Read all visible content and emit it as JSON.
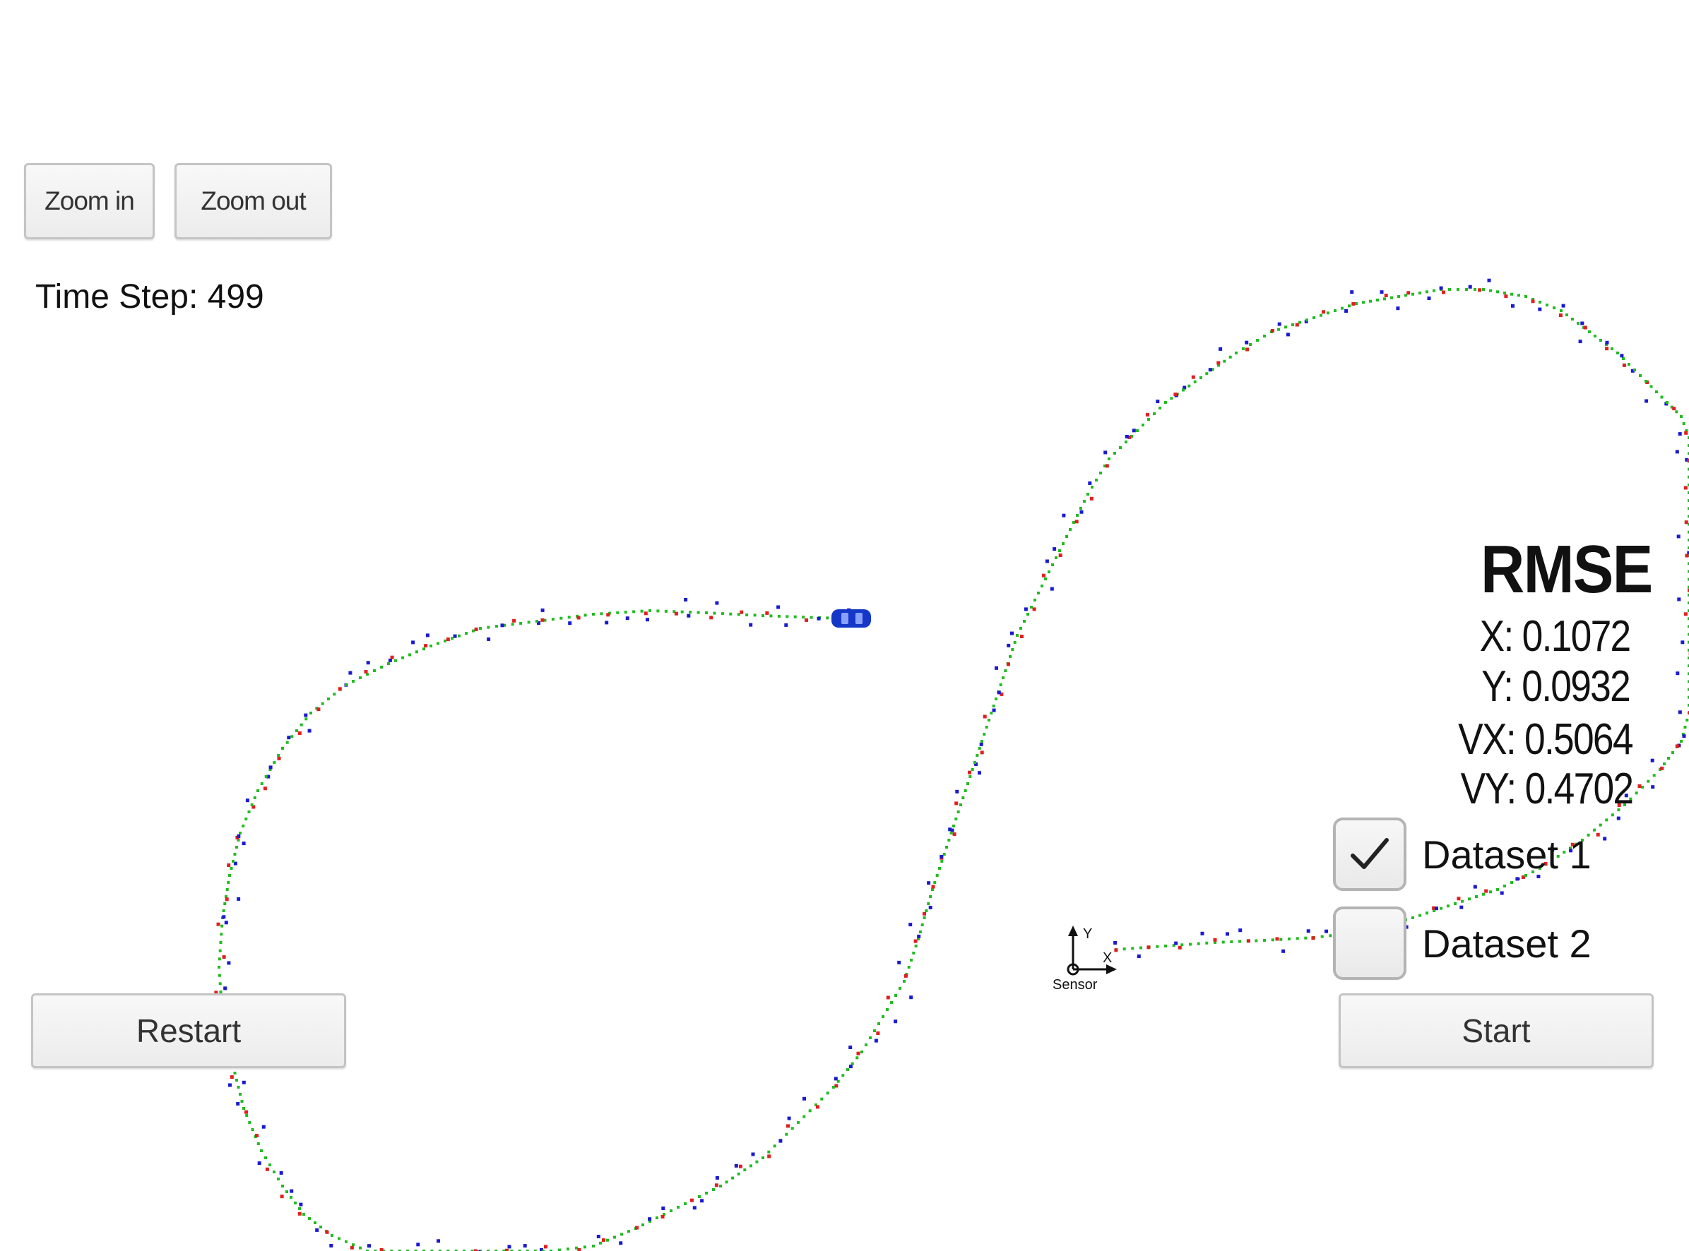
{
  "toolbar": {
    "zoom_in_label": "Zoom in",
    "zoom_out_label": "Zoom out"
  },
  "status": {
    "time_step_text": "Time Step: 499"
  },
  "rmse": {
    "title": "RMSE",
    "x_text": "X: 0.1072",
    "y_text": "Y: 0.0932",
    "vx_text": "VX: 0.5064",
    "vy_text": "VY: 0.4702"
  },
  "datasets": [
    {
      "label": "Dataset 1",
      "checked": true
    },
    {
      "label": "Dataset 2",
      "checked": false
    }
  ],
  "controls": {
    "restart_label": "Restart",
    "start_label": "Start"
  },
  "sensor": {
    "label": "Sensor",
    "x_axis_label": "X",
    "y_axis_label": "Y"
  },
  "colors": {
    "estimate_marker": "#22bb22",
    "lidar_marker": "#e02020",
    "radar_marker": "#1a1ad0",
    "car": "#1537c8",
    "background": "#ffffff"
  },
  "icons": {
    "checkmark": "checkmark-icon",
    "car": "car-icon",
    "sensor_axes": "axes-icon"
  }
}
